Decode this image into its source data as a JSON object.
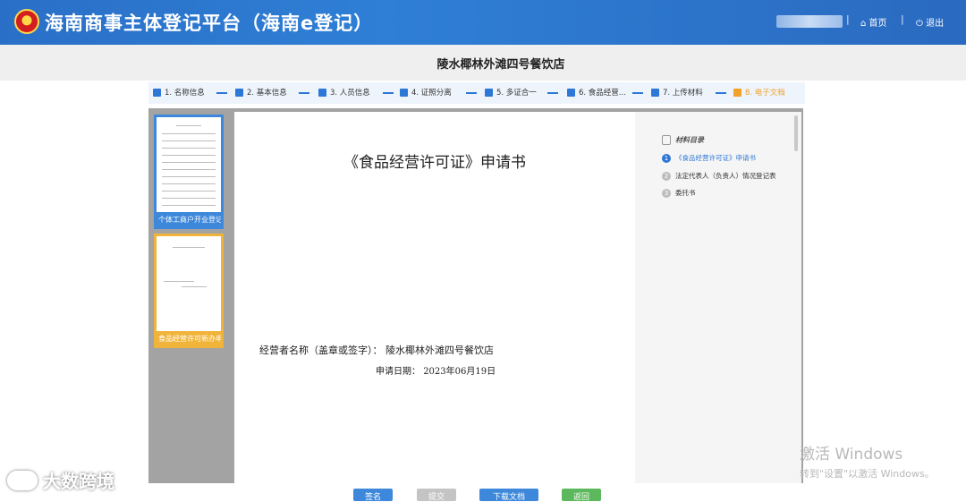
{
  "header": {
    "title": "海南商事主体登记平台（海南e登记）",
    "home_label": "首页",
    "logout_label": "退出",
    "separator": "|"
  },
  "shop_name": "陵水椰林外滩四号餐饮店",
  "steps": [
    {
      "label": "1. 名称信息",
      "icon": "bar-chart-icon"
    },
    {
      "label": "2. 基本信息",
      "icon": "bar-chart-icon"
    },
    {
      "label": "3. 人员信息",
      "icon": "person-icon"
    },
    {
      "label": "4. 证照分离",
      "icon": "id-card-icon"
    },
    {
      "label": "5. 多证合一",
      "icon": "document-icon"
    },
    {
      "label": "6. 食品经营...",
      "icon": "certificate-icon"
    },
    {
      "label": "7. 上传材料",
      "icon": "upload-icon"
    },
    {
      "label": "8. 电子文档",
      "icon": "folder-icon",
      "active": true
    }
  ],
  "thumbnails": [
    {
      "caption": "个体工商户开业登记..."
    },
    {
      "caption": "食品经营许可新办申..."
    }
  ],
  "document": {
    "title": "《食品经营许可证》申请书",
    "operator_label": "经营者名称（盖章或签字）：",
    "operator_value": "陵水椰林外滩四号餐饮店",
    "date_label": "申请日期：",
    "date_value": "2023年06月19日"
  },
  "toc": {
    "heading": "材料目录",
    "items": [
      {
        "num": "1",
        "label": "《食品经营许可证》申请书",
        "active": true
      },
      {
        "num": "2",
        "label": "法定代表人（负责人）情况登记表"
      },
      {
        "num": "3",
        "label": "委托书"
      }
    ]
  },
  "buttons": {
    "sign": {
      "label": "签名",
      "color": "#3d88db"
    },
    "submit": {
      "label": "提交",
      "color": "#c4c4c4"
    },
    "download": {
      "label": "下载文档",
      "color": "#3d88db"
    },
    "back": {
      "label": "返回",
      "color": "#5cb85c"
    }
  },
  "watermark": "大数跨境",
  "activation": {
    "line1": "激活 Windows",
    "line2": "转到\"设置\"以激活 Windows。"
  },
  "colors": {
    "accent": "#2d78d6",
    "active_step": "#f0a22b"
  }
}
